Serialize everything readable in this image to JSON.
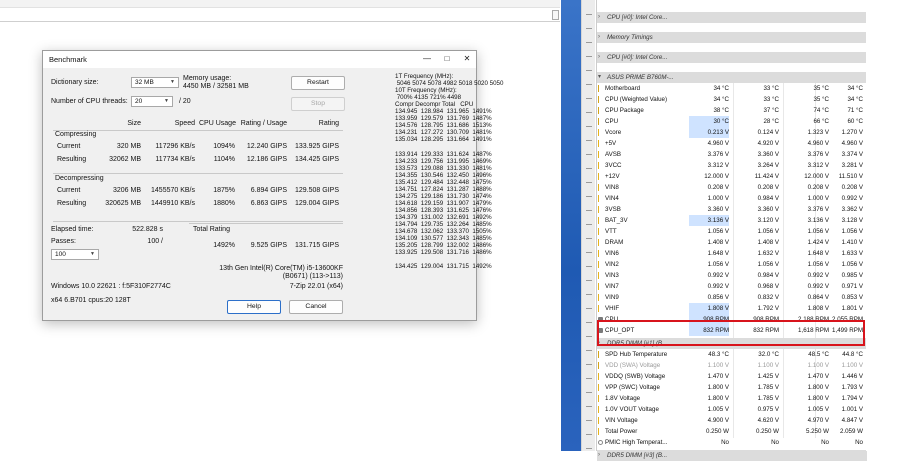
{
  "benchmark": {
    "title": "Benchmark",
    "dict_label": "Dictionary size:",
    "dict_value": "32 MB",
    "mem_label": "Memory usage:",
    "mem_value": "4450 MB / 32581 MB",
    "threads_label": "Number of CPU threads:",
    "threads_value": "20",
    "threads_max": "/ 20",
    "restart": "Restart",
    "stop": "Stop",
    "headers": [
      "Size",
      "Speed",
      "CPU Usage",
      "Rating / Usage",
      "Rating"
    ],
    "compressing": "Compressing",
    "comp_current": [
      "Current",
      "320 MB",
      "117296 KB/s",
      "1094%",
      "12.240 GIPS",
      "133.925 GIPS"
    ],
    "comp_result": [
      "Resulting",
      "32062 MB",
      "117734 KB/s",
      "1104%",
      "12.186 GIPS",
      "134.425 GIPS"
    ],
    "decompressing": "Decompressing",
    "dec_current": [
      "Current",
      "3206 MB",
      "1455570 KB/s",
      "1875%",
      "6.894 GIPS",
      "129.508 GIPS"
    ],
    "dec_result": [
      "Resulting",
      "320625 MB",
      "1449910 KB/s",
      "1880%",
      "6.863 GIPS",
      "129.004 GIPS"
    ],
    "elapsed_label": "Elapsed time:",
    "elapsed_value": "522.828 s",
    "passes_label": "Passes:",
    "passes_value": "100 /",
    "passes_select": "100",
    "total_label": "Total Rating",
    "total": [
      "1492%",
      "9.525 GIPS",
      "131.715 GIPS"
    ],
    "cpu_name_1": "13th Gen Intel(R) Core(TM) i5-13600KF",
    "cpu_name_2": "(B0671) (113->113)",
    "version": "7-Zip 22.01 (x64)",
    "os1": "Windows 10.0 22621 : f:5F310F2774C",
    "os2": "x64 6.B701 cpus:20 128T",
    "help": "Help",
    "cancel": "Cancel",
    "log": "1T Frequency (MHz):\n 5046 5074 5078 4982 5018 5020 5050\n10T Frequency (MHz):\n 700% 4135 721% 4498\nCompr Decompr Total   CPU\n134.945  128.984  131.965  1491%\n133.959  129.579  131.769  1487%\n134.576  128.795  131.686  1513%\n134.231  127.272  130.709  1481%\n135.034  128.295  131.664  1491%\n\n133.914  129.333  131.624  1487%\n134.233  129.756  131.995  1469%\n133.573  129.088  131.330  1481%\n134.355  130.546  132.450  1496%\n135.412  129.484  132.448  1475%\n134.751  127.824  131.287  1488%\n134.275  129.186  131.730  1474%\n134.618  129.159  131.907  1479%\n134.856  128.393  131.625  1476%\n134.379  131.002  132.691  1492%\n134.794  129.735  132.264  1485%\n134.678  132.062  133.370  1505%\n134.109  130.577  132.343  1485%\n135.205  128.799  132.002  1486%\n133.925  129.508  131.716  1486%\n\n134.425  129.004  131.715  1492%"
  },
  "hwinfo": {
    "groups": [
      {
        "label": "CPU [#0]: Intel Core...",
        "row": 0
      },
      {
        "label": "Memory Timings",
        "row": 1
      },
      {
        "label": "CPU [#0]: Intel Core...",
        "row": 2
      },
      {
        "label": "ASUS PRIME B760M-...",
        "row": 3
      }
    ],
    "rows": [
      {
        "type": "temp",
        "label": "Motherboard",
        "v": [
          "34 °C",
          "33 °C",
          "35 °C",
          "34 °C"
        ]
      },
      {
        "type": "temp",
        "label": "CPU (Weighted Value)",
        "v": [
          "34 °C",
          "33 °C",
          "35 °C",
          "34 °C"
        ]
      },
      {
        "type": "temp",
        "label": "CPU Package",
        "v": [
          "38 °C",
          "37 °C",
          "74 °C",
          "71 °C"
        ]
      },
      {
        "type": "temp",
        "label": "CPU",
        "v": [
          "30 °C",
          "28 °C",
          "66 °C",
          "60 °C"
        ],
        "hl": true
      },
      {
        "type": "volt",
        "label": "Vcore",
        "v": [
          "0.213 V",
          "0.124 V",
          "1.323 V",
          "1.270 V"
        ],
        "hl": true
      },
      {
        "type": "volt",
        "label": "+5V",
        "v": [
          "4.960 V",
          "4.920 V",
          "4.960 V",
          "4.960 V"
        ]
      },
      {
        "type": "volt",
        "label": "AVSB",
        "v": [
          "3.376 V",
          "3.360 V",
          "3.376 V",
          "3.374 V"
        ]
      },
      {
        "type": "volt",
        "label": "3VCC",
        "v": [
          "3.312 V",
          "3.264 V",
          "3.312 V",
          "3.281 V"
        ]
      },
      {
        "type": "volt",
        "label": "+12V",
        "v": [
          "12.000 V",
          "11.424 V",
          "12.000 V",
          "11.510 V"
        ]
      },
      {
        "type": "volt",
        "label": "VIN8",
        "v": [
          "0.208 V",
          "0.208 V",
          "0.208 V",
          "0.208 V"
        ]
      },
      {
        "type": "volt",
        "label": "VIN4",
        "v": [
          "1.000 V",
          "0.984 V",
          "1.000 V",
          "0.992 V"
        ]
      },
      {
        "type": "volt",
        "label": "3VSB",
        "v": [
          "3.360 V",
          "3.360 V",
          "3.376 V",
          "3.362 V"
        ]
      },
      {
        "type": "volt",
        "label": "BAT_3V",
        "v": [
          "3.136 V",
          "3.120 V",
          "3.136 V",
          "3.128 V"
        ],
        "hl": true
      },
      {
        "type": "volt",
        "label": "VTT",
        "v": [
          "1.056 V",
          "1.056 V",
          "1.056 V",
          "1.056 V"
        ]
      },
      {
        "type": "volt",
        "label": "DRAM",
        "v": [
          "1.408 V",
          "1.408 V",
          "1.424 V",
          "1.410 V"
        ]
      },
      {
        "type": "volt",
        "label": "VIN6",
        "v": [
          "1.648 V",
          "1.632 V",
          "1.648 V",
          "1.633 V"
        ]
      },
      {
        "type": "volt",
        "label": "VIN2",
        "v": [
          "1.056 V",
          "1.056 V",
          "1.056 V",
          "1.056 V"
        ]
      },
      {
        "type": "volt",
        "label": "VIN3",
        "v": [
          "0.992 V",
          "0.984 V",
          "0.992 V",
          "0.985 V"
        ]
      },
      {
        "type": "volt",
        "label": "VIN7",
        "v": [
          "0.992 V",
          "0.968 V",
          "0.992 V",
          "0.971 V"
        ]
      },
      {
        "type": "volt",
        "label": "VIN9",
        "v": [
          "0.856 V",
          "0.832 V",
          "0.864 V",
          "0.853 V"
        ]
      },
      {
        "type": "volt",
        "label": "VHIF",
        "v": [
          "1.808 V",
          "1.792 V",
          "1.808 V",
          "1.801 V"
        ],
        "hl": true
      },
      {
        "type": "fan",
        "label": "CPU",
        "v": [
          "908 RPM",
          "908 RPM",
          "2,188 RPM",
          "2,055 RPM"
        ],
        "hl": true
      },
      {
        "type": "fan",
        "label": "CPU_OPT",
        "v": [
          "832 RPM",
          "832 RPM",
          "1,618 RPM",
          "1,499 RPM"
        ],
        "hl": true
      },
      {
        "type": "group",
        "label": "DDR5 DIMM [#1] (B..."
      },
      {
        "type": "temp",
        "label": "SPD Hub Temperature",
        "v": [
          "48.3 °C",
          "32.0 °C",
          "48.5 °C",
          "44.8 °C"
        ]
      },
      {
        "type": "temp",
        "label": "VDD (SWA) Voltage",
        "v": [
          "1.100 V",
          "1.100 V",
          "1.100 V",
          "1.100 V"
        ],
        "faded": true
      },
      {
        "type": "volt",
        "label": "VDDQ (SWB) Voltage",
        "v": [
          "1.470 V",
          "1.425 V",
          "1.470 V",
          "1.446 V"
        ]
      },
      {
        "type": "volt",
        "label": "VPP (SWC) Voltage",
        "v": [
          "1.800 V",
          "1.785 V",
          "1.800 V",
          "1.793 V"
        ]
      },
      {
        "type": "volt",
        "label": "1.8V Voltage",
        "v": [
          "1.800 V",
          "1.785 V",
          "1.800 V",
          "1.794 V"
        ]
      },
      {
        "type": "volt",
        "label": "1.0V VOUT Voltage",
        "v": [
          "1.005 V",
          "0.975 V",
          "1.005 V",
          "1.001 V"
        ]
      },
      {
        "type": "volt",
        "label": "VIN Voltage",
        "v": [
          "4.900 V",
          "4.620 V",
          "4.970 V",
          "4.847 V"
        ]
      },
      {
        "type": "power",
        "label": "Total Power",
        "v": [
          "0.250 W",
          "0.250 W",
          "5.250 W",
          "2.059 W"
        ]
      },
      {
        "type": "pmic",
        "label": "PMIC High Temperat...",
        "v": [
          "No",
          "No",
          "No",
          "No"
        ]
      },
      {
        "type": "group",
        "label": "DDR5 DIMM [#3] (B..."
      }
    ]
  }
}
